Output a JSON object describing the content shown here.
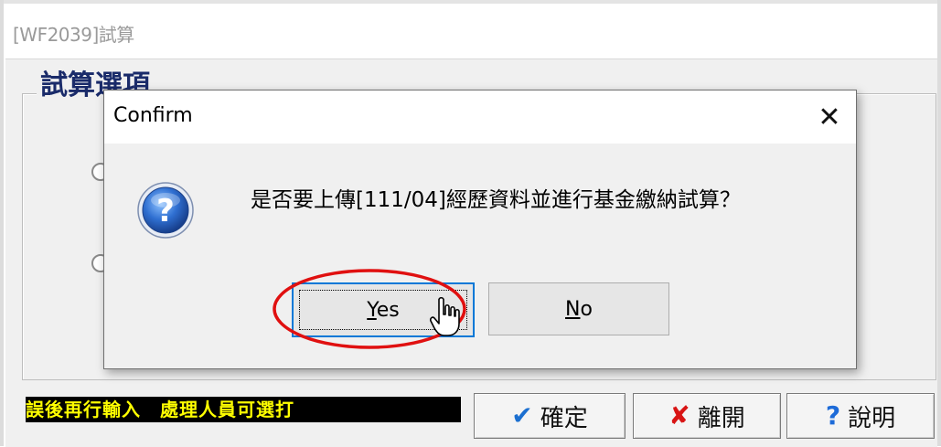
{
  "parent": {
    "title": "[WF2039]試算",
    "group_title": "試算選項",
    "status_text": "誤後再行輸入　處理人員可選打",
    "buttons": {
      "ok_label": "確定",
      "exit_label": "離開",
      "help_label": "說明"
    }
  },
  "dialog": {
    "title": "Confirm",
    "close_glyph": "✕",
    "message": "是否要上傳[111/04]經歷資料並進行基金繳納試算？",
    "yes_label": "Yes",
    "yes_mnemonic": "Y",
    "yes_rest": "es",
    "no_label": "No",
    "no_mnemonic": "N",
    "no_rest": "o",
    "icon": "question-icon"
  },
  "annotation": {
    "highlight_color": "#e01010",
    "highlight_target": "yes-button"
  }
}
